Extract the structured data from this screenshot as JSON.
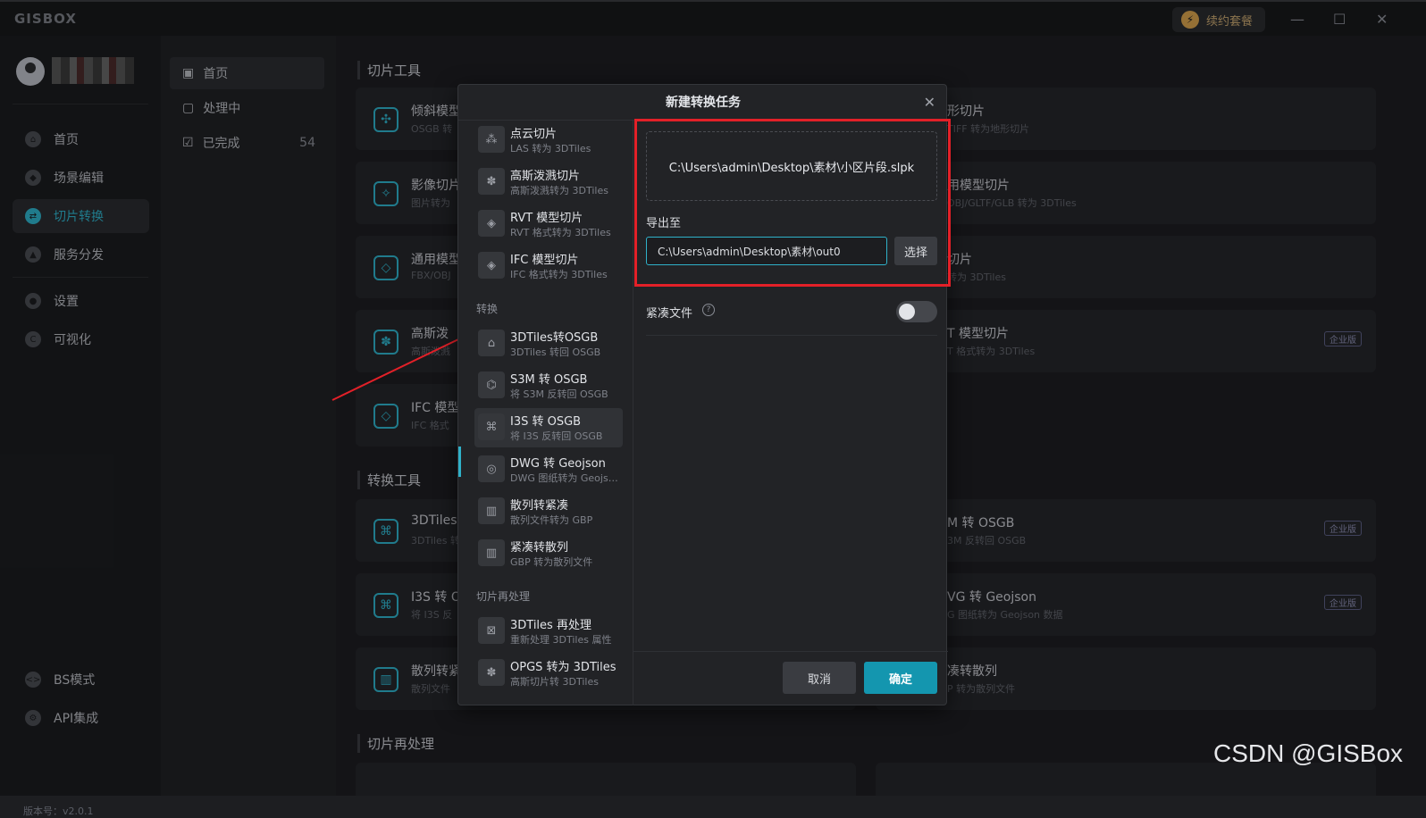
{
  "app": {
    "logo": "GISBOX",
    "renew": "续约套餐",
    "version": "版本号：v2.0.1"
  },
  "sidebar": {
    "items": [
      {
        "label": "首页",
        "icon": "home-icon"
      },
      {
        "label": "场景编辑",
        "icon": "cube-icon"
      },
      {
        "label": "切片转换",
        "icon": "convert-icon",
        "active": true
      },
      {
        "label": "服务分发",
        "icon": "upload-icon"
      },
      {
        "label": "设置",
        "icon": "gear-icon"
      },
      {
        "label": "可视化",
        "icon": "chart-icon"
      }
    ],
    "bottom": [
      {
        "label": "BS模式"
      },
      {
        "label": "API集成"
      }
    ]
  },
  "subnav": {
    "items": [
      {
        "label": "首页"
      },
      {
        "label": "处理中"
      },
      {
        "label": "已完成",
        "count": "54"
      }
    ]
  },
  "main": {
    "sections": [
      "切片工具",
      "转换工具",
      "切片再处理"
    ],
    "cards_left": [
      {
        "title": "倾斜模型",
        "sub": "OSGB 转"
      },
      {
        "title": "影像切片",
        "sub": "图片转为"
      },
      {
        "title": "通用模型",
        "sub": "FBX/OBJ"
      },
      {
        "title": "高斯泼",
        "sub": "高斯泼溅"
      },
      {
        "title": "IFC 模型",
        "sub": "IFC 格式"
      },
      {
        "title": "3DTiles",
        "sub": "3DTiles 转"
      },
      {
        "title": "I3S 转 O",
        "sub": "将 I3S 反"
      },
      {
        "title": "散列转紧",
        "sub": "散列文件"
      }
    ],
    "cards_right": [
      {
        "title": "形切片",
        "sub": "TIFF 转为地形切片"
      },
      {
        "title": "用模型切片",
        "sub": "OBJ/GLTF/GLB 转为 3DTiles"
      },
      {
        "title": "切片",
        "sub": "转为 3DTiles"
      },
      {
        "title": "T 模型切片",
        "sub": "T 格式转为 3DTiles",
        "badge": "企业版"
      },
      {
        "title": "M 转 OSGB",
        "sub": "3M 反转回 OSGB",
        "badge": "企业版"
      },
      {
        "title": "VG 转 Geojson",
        "sub": "G 图纸转为 Geojson 数据",
        "badge": "企业版"
      },
      {
        "title": "凑转散列",
        "sub": "P 转为散列文件"
      }
    ]
  },
  "dialog": {
    "title": "新建转换任务",
    "groups": [
      "转换",
      "切片再处理"
    ],
    "list": [
      {
        "title": "点云切片",
        "sub": "LAS 转为 3DTiles"
      },
      {
        "title": "高斯泼溅切片",
        "sub": "高斯泼溅转为 3DTiles"
      },
      {
        "title": "RVT 模型切片",
        "sub": "RVT 格式转为 3DTiles"
      },
      {
        "title": "IFC 模型切片",
        "sub": "IFC 格式转为 3DTiles"
      },
      {
        "title": "3DTiles转OSGB",
        "sub": "3DTiles 转回 OSGB"
      },
      {
        "title": "S3M 转 OSGB",
        "sub": "将 S3M 反转回 OSGB"
      },
      {
        "title": "I3S 转 OSGB",
        "sub": "将 I3S 反转回 OSGB"
      },
      {
        "title": "DWG 转 Geojson",
        "sub": "DWG 图纸转为 Geojson 数据"
      },
      {
        "title": "散列转紧凑",
        "sub": "散列文件转为 GBP"
      },
      {
        "title": "紧凑转散列",
        "sub": "GBP 转为散列文件"
      },
      {
        "title": "3DTiles 再处理",
        "sub": "重新处理 3DTiles 属性"
      },
      {
        "title": "OPGS 转为 3DTiles",
        "sub": "高斯切片转 3DTiles"
      }
    ],
    "input_file": "C:\\Users\\admin\\Desktop\\素材\\小区片段.slpk",
    "export_label": "导出至",
    "export_path": "C:\\Users\\admin\\Desktop\\素材\\out0",
    "choose": "选择",
    "compact_label": "紧凑文件",
    "cancel": "取消",
    "ok": "确定"
  },
  "watermark": "CSDN @GISBox"
}
